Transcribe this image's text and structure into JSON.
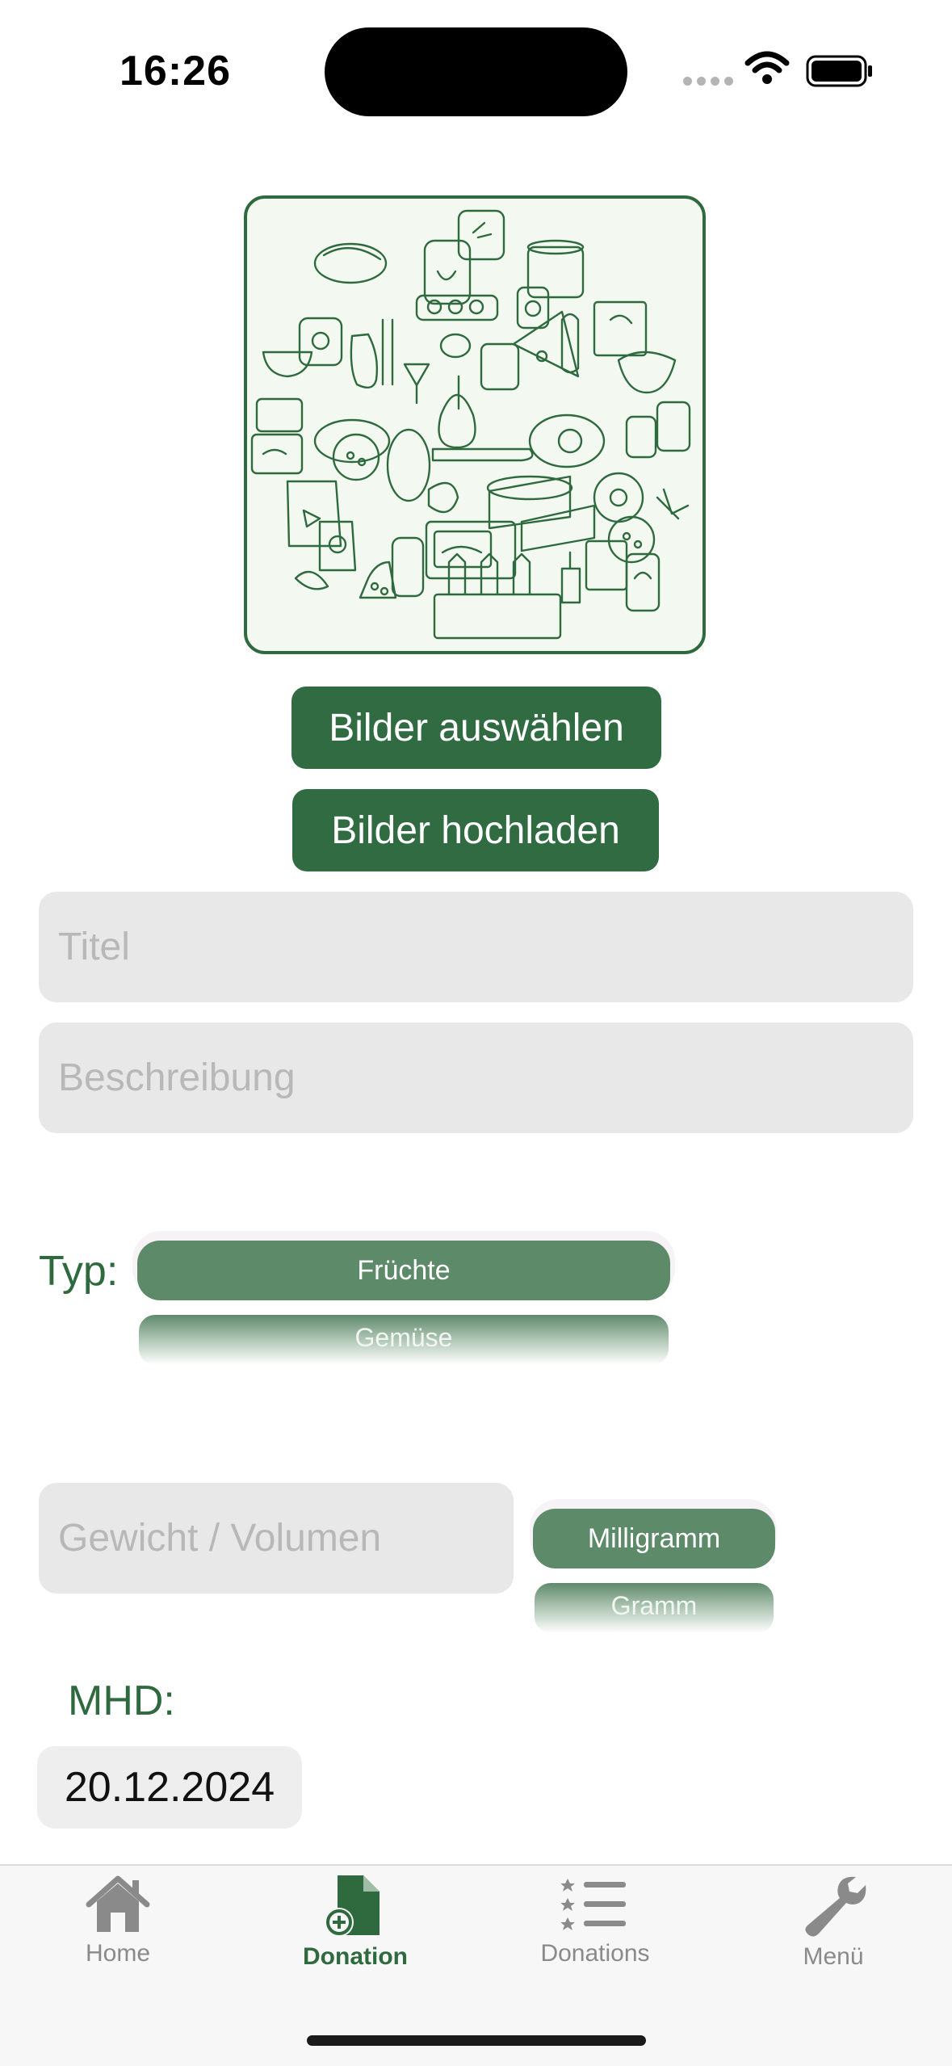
{
  "status_bar": {
    "time": "16:26"
  },
  "image_picker": {
    "select_button": "Bilder auswählen",
    "upload_button": "Bilder hochladen"
  },
  "form": {
    "title_placeholder": "Titel",
    "description_placeholder": "Beschreibung",
    "type_label": "Typ:",
    "type_selected": "Früchte",
    "type_next": "Gemüse",
    "weight_placeholder": "Gewicht / Volumen",
    "unit_selected": "Milligramm",
    "unit_next": "Gramm",
    "mhd_label": "MHD:",
    "mhd_value": "20.12.2024"
  },
  "tabbar": {
    "items": [
      {
        "label": "Home",
        "icon": "house-icon",
        "active": false
      },
      {
        "label": "Donation",
        "icon": "doc-plus-icon",
        "active": true
      },
      {
        "label": "Donations",
        "icon": "list-icon",
        "active": false
      },
      {
        "label": "Menü",
        "icon": "wrench-icon",
        "active": false
      }
    ]
  },
  "colors": {
    "accent": "#306b42",
    "field_bg": "#e8e8e8",
    "tab_inactive": "#8a8a8a"
  }
}
